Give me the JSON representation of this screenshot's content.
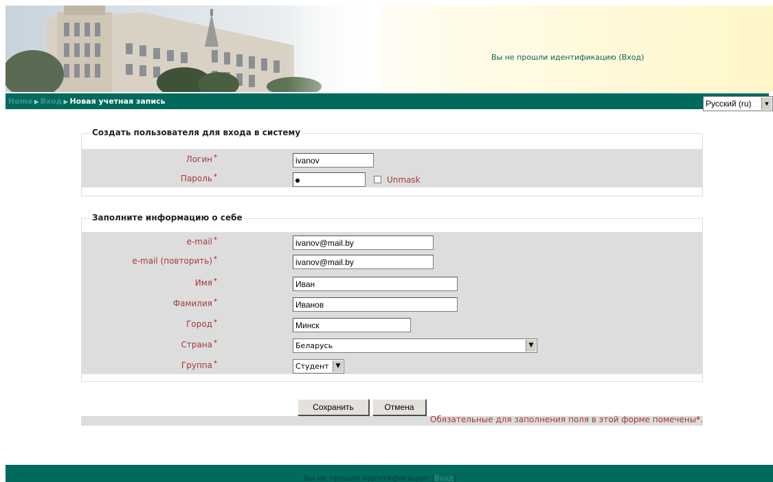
{
  "header": {
    "login_status": "Вы не прошли идентификацию (Вход)"
  },
  "breadcrumb": {
    "home": "Home",
    "login": "Вход",
    "current": "Новая учетная запись"
  },
  "language_select": {
    "value": "Русский (ru)"
  },
  "section_account": {
    "legend": "Создать пользователя для входа в систему",
    "username_label": "Логин",
    "username_value": "ivanov",
    "password_label": "Пароль",
    "unmask_label": "Unmask"
  },
  "section_profile": {
    "legend": "Заполните информацию о себе",
    "fields": [
      {
        "label": "e-mail",
        "value": "ivanov@mail.by"
      },
      {
        "label": "e-mail (повторить)",
        "value": "ivanov@mail.by"
      },
      {
        "label": "Имя",
        "value": "Иван"
      },
      {
        "label": "Фамилия",
        "value": "Иванов"
      },
      {
        "label": "Город",
        "value": "Минск"
      },
      {
        "label": "Страна",
        "value": "Беларусь"
      },
      {
        "label": "Группа",
        "value": "Студент"
      }
    ]
  },
  "required_marker": "*",
  "buttons": {
    "save": "Сохранить",
    "cancel": "Отмена"
  },
  "required_note": "Обязательные для заполнения поля в этой форме помечены",
  "required_note_suffix": ".",
  "footer": {
    "text": "Вы не прошли идентификацию (",
    "link": "Вход",
    "close": ")"
  },
  "colors": {
    "nav_bar": "#006a5c",
    "label_red": "#a53a3a",
    "form_gray": "#dddddd"
  }
}
